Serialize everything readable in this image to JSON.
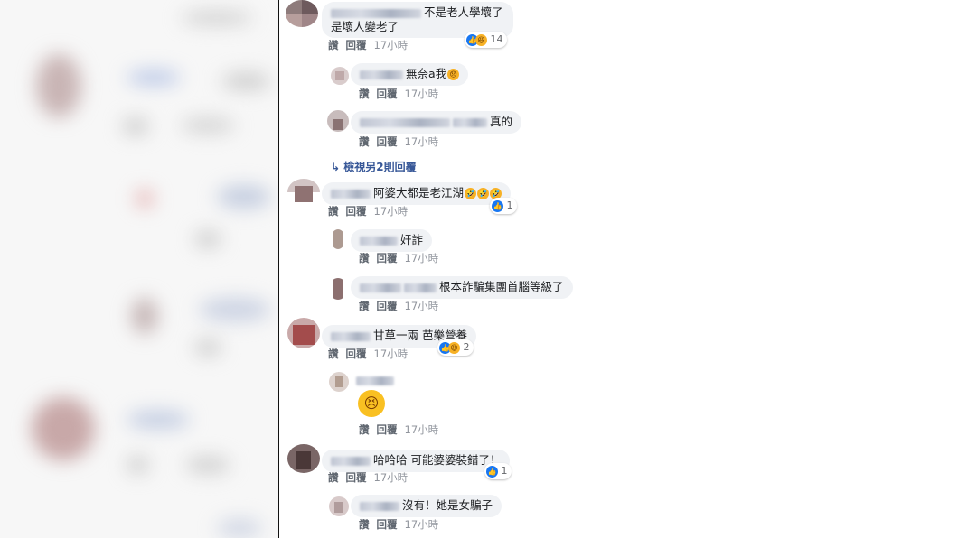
{
  "actions": {
    "like": "讚",
    "reply": "回覆"
  },
  "comments": [
    {
      "text_line1": "不是老人學壞了",
      "text_line2": "是壞人變老了",
      "time": "17小時",
      "reactions_count": "14"
    },
    {
      "text": "無奈a我",
      "time": "17小時"
    },
    {
      "text": "真的",
      "time": "17小時"
    },
    {
      "view_more": "檢視另2則回覆"
    },
    {
      "text": "阿婆大都是老江湖",
      "time": "17小時",
      "reactions_count": "1"
    },
    {
      "text": "奸詐",
      "time": "17小時"
    },
    {
      "text": "根本詐騙集團首腦等級了",
      "time": "17小時"
    },
    {
      "text": "甘草一兩 芭樂營養",
      "time": "17小時",
      "reactions_count": "2"
    },
    {
      "time": "17小時"
    },
    {
      "text": "哈哈哈 可能婆婆裝錯了！",
      "time": "17小時",
      "reactions_count": "1"
    },
    {
      "text": "沒有！她是女騙子",
      "time": "17小時"
    }
  ],
  "icons": {
    "like": "like-reaction-icon",
    "haha": "haha-reaction-icon",
    "reply_arrow": "reply-arrow-icon",
    "big_emoji": "persevering-face-emoji"
  },
  "colors": {
    "link": "#385898",
    "like": "#1877f2",
    "bubble": "#f0f2f5",
    "meta": "#65676b"
  }
}
